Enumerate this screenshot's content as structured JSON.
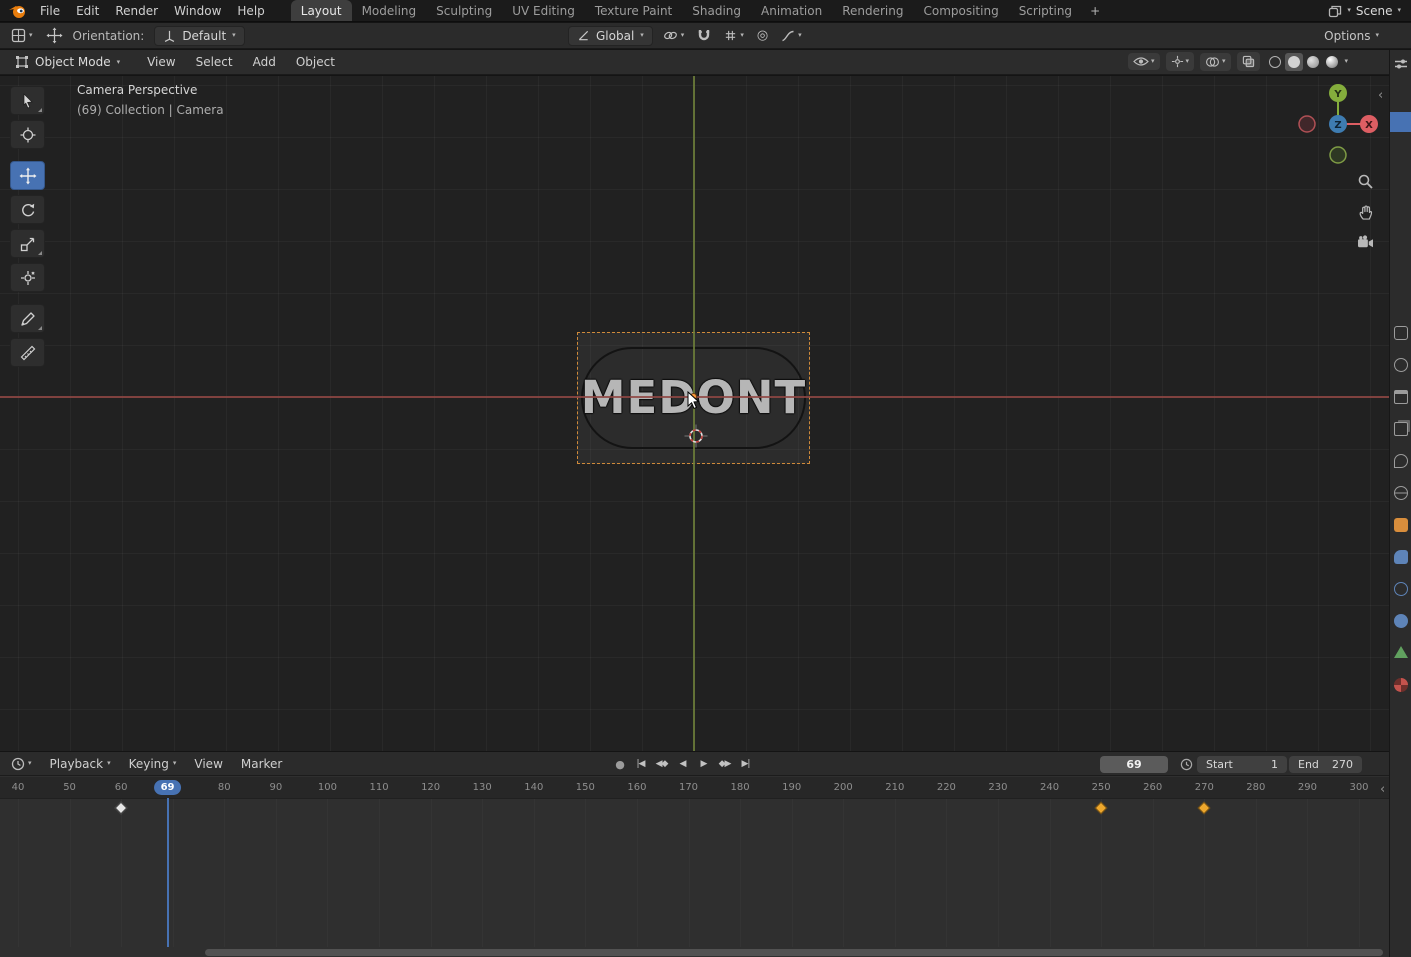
{
  "colors": {
    "accent": "#4772b3",
    "selection_orange": "#cf8a3a",
    "axis_x_red": "#8f4743",
    "axis_y_green": "#6d7f39",
    "gizmo_x": "#dd5e63",
    "gizmo_y": "#84ad3c",
    "gizmo_z": "#3e7cb1"
  },
  "topbar": {
    "menus": [
      "File",
      "Edit",
      "Render",
      "Window",
      "Help"
    ],
    "workspaces": [
      "Layout",
      "Modeling",
      "Sculpting",
      "UV Editing",
      "Texture Paint",
      "Shading",
      "Animation",
      "Rendering",
      "Compositing",
      "Scripting"
    ],
    "active_workspace": "Layout",
    "new_workspace_button": "+",
    "scene_name": "Scene"
  },
  "tool_settings": {
    "orientation_label": "Orientation:",
    "orientation_value": "Default",
    "snap_mode": "Global",
    "options_button": "Options"
  },
  "viewport": {
    "header": {
      "mode": "Object Mode",
      "menus": [
        "View",
        "Select",
        "Add",
        "Object"
      ]
    },
    "overlay": {
      "view_name": "Camera Perspective",
      "context": "(69) Collection | Camera"
    },
    "object_text": "MEDONT",
    "toolbar": [
      "select",
      "cursor",
      "move",
      "rotate",
      "scale",
      "transform",
      "annotate",
      "measure"
    ],
    "active_tool": "move",
    "tools_with_options": [
      "select",
      "scale",
      "annotate"
    ],
    "gizmo_axes": {
      "x": "X",
      "y": "Y",
      "z": "Z"
    }
  },
  "properties_tabs": [
    {
      "name": "tool",
      "style": "s-square",
      "color": "#9c9c9c"
    },
    {
      "name": "render",
      "style": "s-circle",
      "color": "#9c9c9c"
    },
    {
      "name": "output",
      "style": "s-print",
      "color": "#9c9c9c"
    },
    {
      "name": "view-layer",
      "style": "s-stack",
      "color": "#9c9c9c"
    },
    {
      "name": "scene",
      "style": "s-scene",
      "color": "#9c9c9c"
    },
    {
      "name": "world",
      "style": "s-globe",
      "color": "#9c9c9c"
    },
    {
      "name": "object",
      "style": "s-fill-square",
      "color": "#d98e3c"
    },
    {
      "name": "modifiers",
      "style": "s-wrench",
      "color": "#5e84b8"
    },
    {
      "name": "physics",
      "style": "s-circle",
      "color": "#5e84b8"
    },
    {
      "name": "constraints",
      "style": "s-fill-circle",
      "color": "#5e84b8"
    },
    {
      "name": "object-data",
      "style": "s-fill-tri",
      "color": "#61a15f"
    },
    {
      "name": "material",
      "style": "s-checker",
      "color": "#c4534d"
    }
  ],
  "timeline": {
    "menus": [
      {
        "label": "Playback",
        "dropdown": true
      },
      {
        "label": "Keying",
        "dropdown": true
      },
      {
        "label": "View",
        "dropdown": false
      },
      {
        "label": "Marker",
        "dropdown": false
      }
    ],
    "playback_buttons": [
      {
        "name": "record",
        "glyph": "●"
      },
      {
        "name": "jump-to-start",
        "glyph": "|◀"
      },
      {
        "name": "previous-keyframe",
        "glyph": "◀◆"
      },
      {
        "name": "play-reverse",
        "glyph": "◀"
      },
      {
        "name": "play",
        "glyph": "▶"
      },
      {
        "name": "next-keyframe",
        "glyph": "◆▶"
      },
      {
        "name": "jump-to-end",
        "glyph": "▶|"
      }
    ],
    "current_frame": 69,
    "start_label": "Start",
    "start_value": "1",
    "end_label": "End",
    "end_value": "270",
    "ruler": {
      "start": 40,
      "end": 300,
      "step": 10
    },
    "keyframes": [
      {
        "frame": 60,
        "selected": false
      },
      {
        "frame": 250,
        "selected": true
      },
      {
        "frame": 270,
        "selected": true
      }
    ]
  }
}
